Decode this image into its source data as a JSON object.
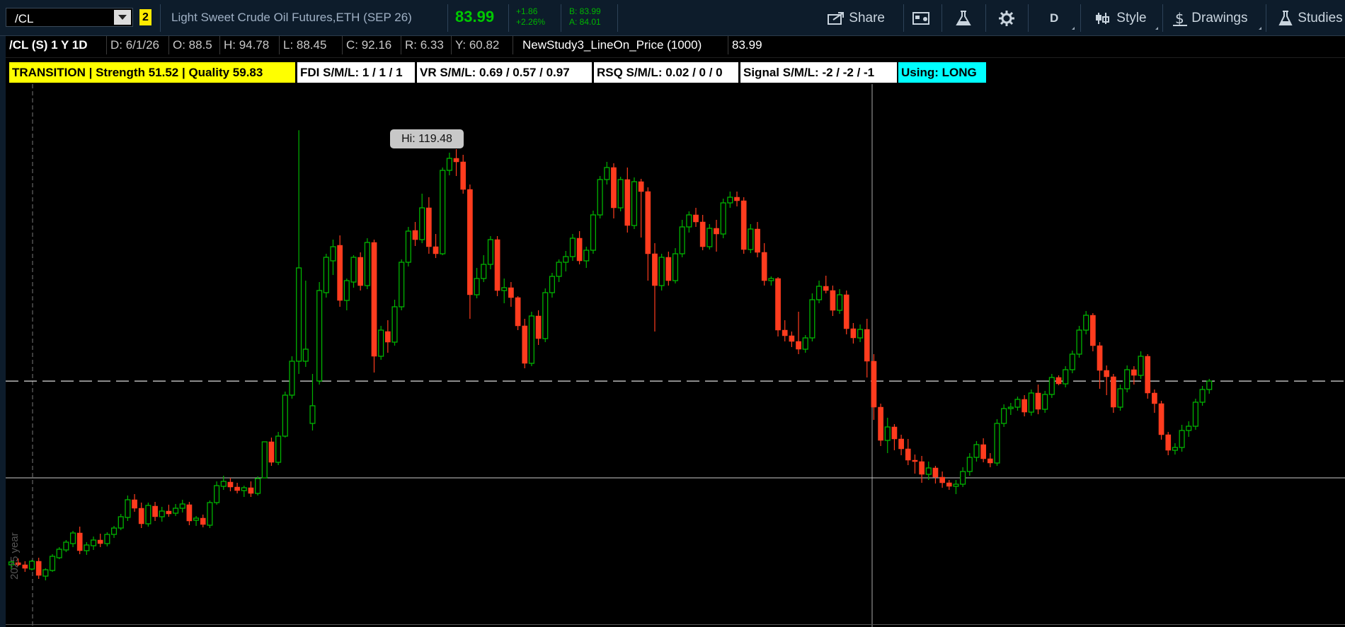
{
  "toolbar": {
    "symbol": "/CL",
    "badge": "2",
    "description": "Light Sweet Crude Oil Futures,ETH (SEP 26)",
    "last": "83.99",
    "change_abs": "+1.86",
    "change_pct": "+2.26%",
    "bid": "B: 83.99",
    "ask": "A: 84.01",
    "share_label": "Share",
    "timeframe_label": "D",
    "style_label": "Style",
    "drawings_label": "Drawings",
    "studies_label": "Studies"
  },
  "info": {
    "title": "/CL (S) 1 Y 1D",
    "date": "D: 6/1/26",
    "open": "O: 88.5",
    "high": "H: 94.78",
    "low": "L: 88.45",
    "close": "C: 92.16",
    "range": "R: 6.33",
    "y": "Y: 60.82",
    "study": "NewStudy3_LineOn_Price (1000)",
    "study_value": "83.99"
  },
  "labels": [
    {
      "text": "TRANSITION | Strength 51.52 | Quality 59.83",
      "bg": "#ffff00"
    },
    {
      "text": "FDI S/M/L: 1 / 1 / 1",
      "bg": "#ffffff"
    },
    {
      "text": "VR  S/M/L: 0.69 / 0.57 / 0.97",
      "bg": "#ffffff"
    },
    {
      "text": "RSQ S/M/L: 0.02 / 0 / 0",
      "bg": "#ffffff"
    },
    {
      "text": "Signal S/M/L: -2 / -2 / -1",
      "bg": "#ffffff"
    },
    {
      "text": "Using: LONG",
      "bg": "#00ffff"
    }
  ],
  "chart": {
    "hi_label": "Hi: 119.48",
    "year_label": "2025 year",
    "up_color": "#00b400",
    "down_color": "#ff3c1e",
    "price_line": 83.99
  },
  "chart_data": {
    "type": "candlestick",
    "series": [
      {
        "name": "/CL",
        "ohlc": [
          [
            58.0,
            58.6,
            57.4,
            58.4
          ],
          [
            58.3,
            58.9,
            57.8,
            58.0
          ],
          [
            58.0,
            58.5,
            57.0,
            57.5
          ],
          [
            57.4,
            58.7,
            57.2,
            58.5
          ],
          [
            58.5,
            59.0,
            56.0,
            56.5
          ],
          [
            56.4,
            57.5,
            55.8,
            57.3
          ],
          [
            57.2,
            59.5,
            57.0,
            59.2
          ],
          [
            59.0,
            60.5,
            58.8,
            60.2
          ],
          [
            60.1,
            61.5,
            59.8,
            61.2
          ],
          [
            61.0,
            62.8,
            60.5,
            62.5
          ],
          [
            62.5,
            63.4,
            59.5,
            60.0
          ],
          [
            60.0,
            61.2,
            59.4,
            60.8
          ],
          [
            60.7,
            62.0,
            60.1,
            61.5
          ],
          [
            61.5,
            62.4,
            60.5,
            61.0
          ],
          [
            61.0,
            62.6,
            60.6,
            62.3
          ],
          [
            62.3,
            63.5,
            61.8,
            63.2
          ],
          [
            63.2,
            65.2,
            62.9,
            64.8
          ],
          [
            64.7,
            67.8,
            64.2,
            67.2
          ],
          [
            67.2,
            68.0,
            65.5,
            66.0
          ],
          [
            66.0,
            66.8,
            63.2,
            63.8
          ],
          [
            63.8,
            66.8,
            63.4,
            66.4
          ],
          [
            66.3,
            66.9,
            64.2,
            64.8
          ],
          [
            64.8,
            66.2,
            64.1,
            65.6
          ],
          [
            65.6,
            66.5,
            64.8,
            65.2
          ],
          [
            65.3,
            66.6,
            64.9,
            66.0
          ],
          [
            66.0,
            67.2,
            65.4,
            66.6
          ],
          [
            66.5,
            66.9,
            63.6,
            64.2
          ],
          [
            64.3,
            64.9,
            63.5,
            64.6
          ],
          [
            64.6,
            65.1,
            63.3,
            63.7
          ],
          [
            63.6,
            67.1,
            63.2,
            66.8
          ],
          [
            66.8,
            69.8,
            66.5,
            69.2
          ],
          [
            69.1,
            70.6,
            68.6,
            69.8
          ],
          [
            69.7,
            70.3,
            68.4,
            69.0
          ],
          [
            69.0,
            69.6,
            68.1,
            68.5
          ],
          [
            68.5,
            69.2,
            67.6,
            68.9
          ],
          [
            68.9,
            69.8,
            67.6,
            68.1
          ],
          [
            68.1,
            70.5,
            67.8,
            70.2
          ],
          [
            70.3,
            71.0,
            73.5,
            75.4
          ],
          [
            75.4,
            76.0,
            72.0,
            72.5
          ],
          [
            72.5,
            76.8,
            72.1,
            76.2
          ],
          [
            76.2,
            82.5,
            76.0,
            82.0
          ],
          [
            82.0,
            87.5,
            81.5,
            86.8
          ],
          [
            86.8,
            119.48,
            85.0,
            100.0
          ],
          [
            86.8,
            98.2,
            86.0,
            88.5
          ],
          [
            78.0,
            85.0,
            77.0,
            80.5
          ],
          [
            84.0,
            98.0,
            83.5,
            96.8
          ],
          [
            96.5,
            102.0,
            95.8,
            101.5
          ],
          [
            101.0,
            104.0,
            99.0,
            103.0
          ],
          [
            103.2,
            104.6,
            94.5,
            95.4
          ],
          [
            95.4,
            98.5,
            94.0,
            98.2
          ],
          [
            98.0,
            101.8,
            97.2,
            101.5
          ],
          [
            101.5,
            102.2,
            96.8,
            97.5
          ],
          [
            97.5,
            104.2,
            97.0,
            103.6
          ],
          [
            103.6,
            104.0,
            85.2,
            87.5
          ],
          [
            87.5,
            91.8,
            87.0,
            91.2
          ],
          [
            91.0,
            92.6,
            88.0,
            89.5
          ],
          [
            89.5,
            95.5,
            89.0,
            94.5
          ],
          [
            94.5,
            101.2,
            94.0,
            100.8
          ],
          [
            100.8,
            105.8,
            100.2,
            105.2
          ],
          [
            105.3,
            106.5,
            103.1,
            104.0
          ],
          [
            104.0,
            110.5,
            103.5,
            108.5
          ],
          [
            108.5,
            110.0,
            102.0,
            103.0
          ],
          [
            103.0,
            104.8,
            101.4,
            102.0
          ],
          [
            102.0,
            114.2,
            101.8,
            113.8
          ],
          [
            113.8,
            116.3,
            113.1,
            115.5
          ],
          [
            115.5,
            116.8,
            113.0,
            115.0
          ],
          [
            115.0,
            116.0,
            110.5,
            111.1
          ],
          [
            111.1,
            111.8,
            92.8,
            96.2
          ],
          [
            96.2,
            100.0,
            95.7,
            98.5
          ],
          [
            98.5,
            101.8,
            98.0,
            100.5
          ],
          [
            100.5,
            104.5,
            99.8,
            104.0
          ],
          [
            104.0,
            104.5,
            96.0,
            96.8
          ],
          [
            96.8,
            98.5,
            95.0,
            97.2
          ],
          [
            97.2,
            98.0,
            94.5,
            95.8
          ],
          [
            95.8,
            96.0,
            91.2,
            91.8
          ],
          [
            91.8,
            92.8,
            85.8,
            86.5
          ],
          [
            86.5,
            93.8,
            86.1,
            93.2
          ],
          [
            93.2,
            94.0,
            89.1,
            90.0
          ],
          [
            90.0,
            97.1,
            89.5,
            96.5
          ],
          [
            96.5,
            99.3,
            95.8,
            98.8
          ],
          [
            98.8,
            101.2,
            98.0,
            100.8
          ],
          [
            100.8,
            102.4,
            99.5,
            101.6
          ],
          [
            101.6,
            104.8,
            101.0,
            104.2
          ],
          [
            104.2,
            105.2,
            100.5,
            101.0
          ],
          [
            101.0,
            103.0,
            100.0,
            102.5
          ],
          [
            102.5,
            108.1,
            102.0,
            107.5
          ],
          [
            107.5,
            113.0,
            107.0,
            112.5
          ],
          [
            112.5,
            115.0,
            111.8,
            114.2
          ],
          [
            114.2,
            114.8,
            107.0,
            108.5
          ],
          [
            108.5,
            112.9,
            108.0,
            112.5
          ],
          [
            112.5,
            114.2,
            105.0,
            106.0
          ],
          [
            106.0,
            112.8,
            105.5,
            112.2
          ],
          [
            112.2,
            112.6,
            104.3,
            110.8
          ],
          [
            110.8,
            111.4,
            98.2,
            102.0
          ],
          [
            102.0,
            103.5,
            91.0,
            97.5
          ],
          [
            97.5,
            102.0,
            96.8,
            101.5
          ],
          [
            101.5,
            102.3,
            97.5,
            98.2
          ],
          [
            98.2,
            102.8,
            97.8,
            102.0
          ],
          [
            102.0,
            106.8,
            101.5,
            105.8
          ],
          [
            105.8,
            108.0,
            105.0,
            107.5
          ],
          [
            107.5,
            108.5,
            105.8,
            106.5
          ],
          [
            106.5,
            107.5,
            102.5,
            103.0
          ],
          [
            103.0,
            106.2,
            102.6,
            105.6
          ],
          [
            105.6,
            106.8,
            102.3,
            104.8
          ],
          [
            104.8,
            109.8,
            104.2,
            109.2
          ],
          [
            109.2,
            110.8,
            108.5,
            110.0
          ],
          [
            110.0,
            110.8,
            108.7,
            109.5
          ],
          [
            109.5,
            110.0,
            102.0,
            102.6
          ],
          [
            102.6,
            106.2,
            102.1,
            105.5
          ],
          [
            105.5,
            106.5,
            101.5,
            102.2
          ],
          [
            102.2,
            103.5,
            97.5,
            98.2
          ],
          [
            98.2,
            98.8,
            97.5,
            98.5
          ],
          [
            98.5,
            98.7,
            90.3,
            91.2
          ],
          [
            91.2,
            92.6,
            89.6,
            90.4
          ],
          [
            90.4,
            91.0,
            88.8,
            89.6
          ],
          [
            89.6,
            93.8,
            87.8,
            88.5
          ],
          [
            88.5,
            90.5,
            88.0,
            90.1
          ],
          [
            90.1,
            96.4,
            89.6,
            95.5
          ],
          [
            95.5,
            98.2,
            95.0,
            97.4
          ],
          [
            97.4,
            98.9,
            96.4,
            96.8
          ],
          [
            96.8,
            97.5,
            93.2,
            94.0
          ],
          [
            94.0,
            97.0,
            93.5,
            96.2
          ],
          [
            96.2,
            96.8,
            90.6,
            91.4
          ],
          [
            91.4,
            92.2,
            89.3,
            90.1
          ],
          [
            90.1,
            92.0,
            89.5,
            91.3
          ],
          [
            91.3,
            92.8,
            84.5,
            86.8
          ],
          [
            86.8,
            87.8,
            78.5,
            80.3
          ],
          [
            80.3,
            80.8,
            74.8,
            75.6
          ],
          [
            75.6,
            78.8,
            73.8,
            77.5
          ],
          [
            77.5,
            77.9,
            74.2,
            75.8
          ],
          [
            75.8,
            76.4,
            73.5,
            74.4
          ],
          [
            74.4,
            75.8,
            72.1,
            72.8
          ],
          [
            72.8,
            73.6,
            70.9,
            72.6
          ],
          [
            72.6,
            73.4,
            69.6,
            70.8
          ],
          [
            70.8,
            72.6,
            70.0,
            71.7
          ],
          [
            71.7,
            72.0,
            69.5,
            70.4
          ],
          [
            70.4,
            71.2,
            68.9,
            69.6
          ],
          [
            69.6,
            70.0,
            68.6,
            69.1
          ],
          [
            69.1,
            70.0,
            68.0,
            69.4
          ],
          [
            69.4,
            71.8,
            69.0,
            71.2
          ],
          [
            71.2,
            73.8,
            70.6,
            73.2
          ],
          [
            73.2,
            75.5,
            72.6,
            75.0
          ],
          [
            75.0,
            75.9,
            72.5,
            73.0
          ],
          [
            73.0,
            73.8,
            71.8,
            72.4
          ],
          [
            72.4,
            78.6,
            72.0,
            78.0
          ],
          [
            78.0,
            80.7,
            77.5,
            80.1
          ],
          [
            80.1,
            80.9,
            79.2,
            80.3
          ],
          [
            80.3,
            81.8,
            79.8,
            81.4
          ],
          [
            81.4,
            82.0,
            79.0,
            79.6
          ],
          [
            79.6,
            82.8,
            79.1,
            82.3
          ],
          [
            82.3,
            83.5,
            79.3,
            80.0
          ],
          [
            80.0,
            82.6,
            79.5,
            82.1
          ],
          [
            82.1,
            85.0,
            81.6,
            84.5
          ],
          [
            84.5,
            84.8,
            83.4,
            83.6
          ],
          [
            83.6,
            86.1,
            83.1,
            85.6
          ],
          [
            85.6,
            88.3,
            85.1,
            87.8
          ],
          [
            87.8,
            91.8,
            87.3,
            91.2
          ],
          [
            91.2,
            93.9,
            90.6,
            93.3
          ],
          [
            93.3,
            93.6,
            88.2,
            89.0
          ],
          [
            89.0,
            89.5,
            82.9,
            85.5
          ],
          [
            85.5,
            86.2,
            82.0,
            84.6
          ],
          [
            84.6,
            85.0,
            79.5,
            80.3
          ],
          [
            80.3,
            83.5,
            79.8,
            82.9
          ],
          [
            82.9,
            86.2,
            82.4,
            85.6
          ],
          [
            85.6,
            86.1,
            83.5,
            84.8
          ],
          [
            84.8,
            88.2,
            84.3,
            87.5
          ],
          [
            87.5,
            87.8,
            81.5,
            82.3
          ],
          [
            82.3,
            82.8,
            79.5,
            80.8
          ],
          [
            80.8,
            81.2,
            75.7,
            76.4
          ],
          [
            76.4,
            76.8,
            73.5,
            74.2
          ],
          [
            74.2,
            75.2,
            73.6,
            74.6
          ],
          [
            74.6,
            77.8,
            74.0,
            77.0
          ],
          [
            77.0,
            78.3,
            76.1,
            77.6
          ],
          [
            77.6,
            81.5,
            77.1,
            81.0
          ],
          [
            81.0,
            83.3,
            80.5,
            82.8
          ],
          [
            82.8,
            84.3,
            82.2,
            83.99
          ]
        ]
      }
    ],
    "ylim": [
      50,
      122
    ],
    "reference_lines": [
      83.99,
      70.3
    ],
    "annotations": [
      "Hi: 119.48",
      "2025 year"
    ]
  }
}
